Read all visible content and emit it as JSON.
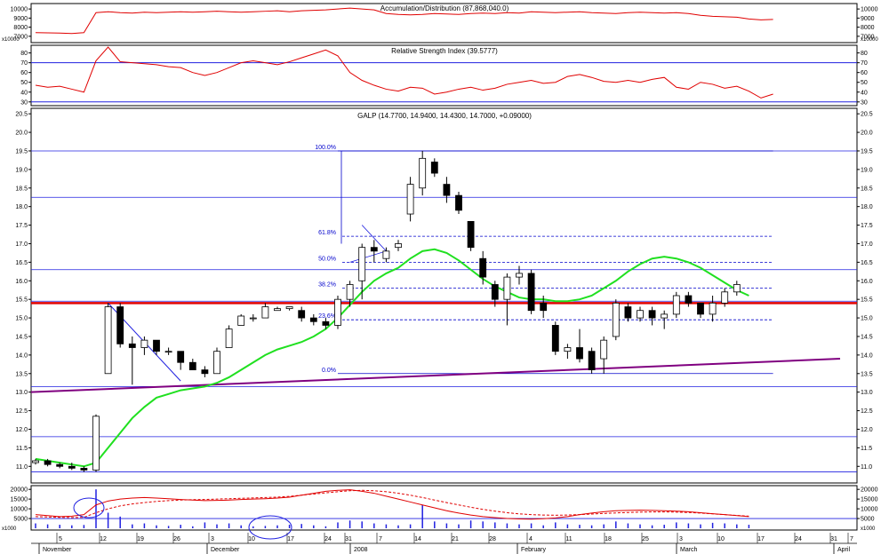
{
  "colors": {
    "frame": "#000000",
    "grid": "#c8c8c8",
    "blue_line": "#2020e0",
    "red_line": "#e00000",
    "support": "#800080",
    "ma": "#20e020",
    "fib": "#0000cc",
    "indicator": "#e00000"
  },
  "panels": {
    "ad": {
      "title": "Accumulation/Distribution (87,868,040.0)",
      "ticks": [
        "10000",
        "9000",
        "8000",
        "7000"
      ],
      "scale_label": "x10000",
      "ylim": [
        6500,
        10500
      ],
      "values": [
        7400,
        7380,
        7350,
        7300,
        7400,
        9600,
        9700,
        9600,
        9550,
        9650,
        9600,
        9650,
        9700,
        9650,
        9700,
        9750,
        9700,
        9650,
        9700,
        9750,
        9800,
        9700,
        9800,
        9850,
        9900,
        10000,
        10100,
        10000,
        9900,
        9500,
        9400,
        9350,
        9400,
        9500,
        9450,
        9400,
        9500,
        9550,
        9500,
        9600,
        9550,
        9700,
        9650,
        9600,
        9650,
        9700,
        9600,
        9550,
        9500,
        9600,
        9650,
        9600,
        9550,
        9600,
        9500,
        9300,
        9200,
        9150,
        9100,
        8900,
        8800,
        8850
      ]
    },
    "rsi": {
      "title": "Relative Strength Index (39.5777)",
      "ticks": [
        "80",
        "70",
        "60",
        "50",
        "40",
        "30"
      ],
      "ylim": [
        28,
        86
      ],
      "levels": [
        70,
        30
      ],
      "values": [
        47,
        45,
        46,
        43,
        40,
        72,
        86,
        71,
        70,
        69,
        68,
        66,
        65,
        60,
        57,
        60,
        65,
        70,
        72,
        70,
        68,
        71,
        75,
        79,
        83,
        77,
        60,
        52,
        47,
        43,
        41,
        45,
        44,
        38,
        40,
        43,
        45,
        42,
        44,
        48,
        50,
        52,
        49,
        50,
        56,
        58,
        55,
        51,
        50,
        52,
        50,
        53,
        55,
        45,
        43,
        50,
        48,
        44,
        46,
        41,
        34,
        38
      ]
    },
    "price": {
      "title": "GALP (14.7700, 14.9400, 14.4300, 14.7000, +0.09000)",
      "ticks": [
        "20.5",
        "20.0",
        "19.5",
        "19.0",
        "18.5",
        "18.0",
        "17.5",
        "17.0",
        "16.5",
        "16.0",
        "15.5",
        "15.0",
        "14.5",
        "14.0",
        "13.5",
        "13.0",
        "12.5",
        "12.0",
        "11.5",
        "11.0"
      ],
      "ylim": [
        10.6,
        20.6
      ],
      "hlines": [
        19.5,
        18.25,
        16.3,
        15.45,
        13.15,
        11.8,
        10.85
      ],
      "resistance": 15.4,
      "fib_levels": [
        {
          "label": "100.0%",
          "value": 19.5
        },
        {
          "label": "61.8%",
          "value": 17.2
        },
        {
          "label": "50.0%",
          "value": 16.5
        },
        {
          "label": "38.2%",
          "value": 15.8
        },
        {
          "label": "23.6%",
          "value": 14.95
        },
        {
          "label": "0.0%",
          "value": 13.5
        }
      ],
      "ohlc": [
        [
          11.1,
          11.2,
          11.05,
          11.15
        ],
        [
          11.15,
          11.2,
          11.0,
          11.05
        ],
        [
          11.05,
          11.1,
          10.95,
          11.0
        ],
        [
          11.0,
          11.1,
          10.9,
          10.95
        ],
        [
          10.95,
          11.0,
          10.85,
          10.9
        ],
        [
          10.9,
          12.4,
          10.85,
          12.35
        ],
        [
          13.5,
          15.4,
          13.5,
          15.3
        ],
        [
          15.3,
          15.4,
          14.2,
          14.3
        ],
        [
          14.3,
          14.5,
          13.2,
          14.2
        ],
        [
          14.2,
          14.5,
          14.0,
          14.4
        ],
        [
          14.4,
          14.4,
          14.0,
          14.1
        ],
        [
          14.1,
          14.2,
          14.0,
          14.1
        ],
        [
          14.1,
          14.1,
          13.6,
          13.8
        ],
        [
          13.8,
          13.9,
          13.6,
          13.6
        ],
        [
          13.6,
          13.7,
          13.4,
          13.5
        ],
        [
          13.5,
          14.2,
          13.5,
          14.1
        ],
        [
          14.2,
          14.8,
          14.2,
          14.7
        ],
        [
          14.8,
          15.1,
          14.8,
          15.05
        ],
        [
          15.0,
          15.1,
          14.9,
          15.0
        ],
        [
          15.0,
          15.4,
          15.0,
          15.3
        ],
        [
          15.2,
          15.3,
          15.2,
          15.25
        ],
        [
          15.25,
          15.3,
          15.2,
          15.3
        ],
        [
          15.2,
          15.3,
          14.9,
          15.0
        ],
        [
          15.0,
          15.1,
          14.8,
          14.9
        ],
        [
          14.9,
          15.0,
          14.7,
          14.8
        ],
        [
          14.8,
          15.6,
          14.7,
          15.5
        ],
        [
          15.5,
          16.0,
          15.3,
          15.9
        ],
        [
          16.0,
          17.0,
          15.5,
          16.9
        ],
        [
          16.9,
          17.1,
          16.5,
          16.8
        ],
        [
          16.6,
          16.9,
          16.5,
          16.8
        ],
        [
          16.9,
          17.1,
          16.8,
          17.0
        ],
        [
          17.8,
          18.8,
          17.6,
          18.6
        ],
        [
          18.5,
          19.5,
          18.3,
          19.3
        ],
        [
          19.2,
          19.3,
          18.8,
          18.9
        ],
        [
          18.6,
          18.8,
          18.1,
          18.3
        ],
        [
          18.3,
          18.4,
          17.8,
          17.9
        ],
        [
          17.6,
          17.6,
          16.8,
          16.9
        ],
        [
          16.6,
          16.8,
          15.9,
          16.1
        ],
        [
          15.9,
          16.0,
          15.3,
          15.5
        ],
        [
          15.5,
          16.2,
          14.8,
          16.1
        ],
        [
          16.1,
          16.4,
          15.9,
          16.2
        ],
        [
          16.2,
          16.3,
          15.1,
          15.2
        ],
        [
          15.4,
          15.6,
          15.0,
          15.2
        ],
        [
          14.8,
          14.9,
          14.0,
          14.1
        ],
        [
          14.1,
          14.3,
          13.9,
          14.2
        ],
        [
          14.2,
          14.7,
          13.8,
          13.9
        ],
        [
          14.1,
          14.2,
          13.5,
          13.6
        ],
        [
          13.9,
          14.5,
          13.5,
          14.4
        ],
        [
          14.5,
          15.5,
          14.4,
          15.4
        ],
        [
          15.3,
          15.4,
          14.9,
          15.0
        ],
        [
          15.0,
          15.3,
          14.9,
          15.2
        ],
        [
          15.2,
          15.3,
          14.8,
          15.0
        ],
        [
          15.0,
          15.2,
          14.7,
          15.1
        ],
        [
          15.1,
          15.7,
          15.0,
          15.6
        ],
        [
          15.6,
          15.7,
          15.3,
          15.4
        ],
        [
          15.4,
          15.4,
          15.0,
          15.1
        ],
        [
          15.1,
          15.6,
          14.9,
          15.4
        ],
        [
          15.4,
          15.8,
          15.3,
          15.7
        ],
        [
          15.7,
          16.0,
          15.6,
          15.9
        ]
      ],
      "ma": [
        11.2,
        11.15,
        11.1,
        11.05,
        11.0,
        11.1,
        11.5,
        11.9,
        12.3,
        12.6,
        12.85,
        12.95,
        13.05,
        13.1,
        13.15,
        13.25,
        13.4,
        13.6,
        13.8,
        14.0,
        14.15,
        14.25,
        14.35,
        14.5,
        14.7,
        15.0,
        15.35,
        15.7,
        16.0,
        16.2,
        16.35,
        16.6,
        16.8,
        16.85,
        16.75,
        16.55,
        16.3,
        16.05,
        15.85,
        15.7,
        15.55,
        15.5,
        15.5,
        15.45,
        15.45,
        15.5,
        15.6,
        15.8,
        16.0,
        16.25,
        16.45,
        16.6,
        16.65,
        16.6,
        16.5,
        16.35,
        16.15,
        15.95,
        15.75,
        15.6
      ]
    },
    "volume": {
      "ticks": [
        "20000",
        "15000",
        "10000",
        "5000"
      ],
      "scale_label": "x1000",
      "ylim": [
        0,
        21000
      ],
      "values": [
        2500,
        2000,
        1800,
        1500,
        1700,
        20000,
        8000,
        6000,
        2000,
        2500,
        1500,
        1200,
        1800,
        1000,
        3000,
        2000,
        2500,
        1500,
        1000,
        1200,
        1500,
        1800,
        2200,
        1500,
        1000,
        3000,
        4000,
        3500,
        2500,
        2000,
        1500,
        2000,
        12000,
        3500,
        2500,
        2000,
        4000,
        3500,
        3000,
        2500,
        2000,
        2500,
        1500,
        3000,
        2000,
        1800,
        1500,
        2000,
        3500,
        2500,
        2000,
        1500,
        1800,
        3000,
        2500,
        2000,
        2800,
        2500,
        2000,
        1800
      ],
      "series_a": [
        7000,
        6500,
        6000,
        6200,
        7000,
        12000,
        14000,
        15000,
        15500,
        15800,
        15500,
        15200,
        14800,
        14500,
        14200,
        14300,
        14500,
        14800,
        15000,
        15200,
        15500,
        16000,
        17000,
        18000,
        19000,
        19500,
        19800,
        19000,
        18000,
        16500,
        15000,
        13500,
        12000,
        10500,
        9000,
        7800,
        6800,
        6000,
        5500,
        5000,
        4800,
        4700,
        4900,
        5300,
        6000,
        7000,
        7800,
        8500,
        9000,
        9200,
        9300,
        9200,
        9000,
        8800,
        8500,
        8000,
        7500,
        7000,
        6500,
        6000
      ],
      "series_b": [
        6000,
        5800,
        5600,
        5500,
        5600,
        8000,
        10000,
        11500,
        12500,
        13200,
        13800,
        14200,
        14500,
        14700,
        14800,
        15000,
        15200,
        15400,
        15600,
        15800,
        16000,
        16400,
        17000,
        17600,
        18200,
        18800,
        19300,
        19500,
        19300,
        18800,
        18000,
        17000,
        15800,
        14500,
        13200,
        12000,
        10800,
        9700,
        8800,
        8000,
        7400,
        7000,
        6800,
        6700,
        6800,
        7000,
        7300,
        7600,
        7900,
        8100,
        8300,
        8400,
        8400,
        8300,
        8100,
        7800,
        7400,
        7000,
        6600,
        6200
      ]
    }
  },
  "xaxis": {
    "day_labels": [
      "5",
      "12",
      "19",
      "26",
      "3",
      "10",
      "17",
      "24",
      "31",
      "7",
      "14",
      "21",
      "28",
      "4",
      "11",
      "18",
      "25",
      "3",
      "10",
      "17",
      "24",
      "31",
      "7"
    ],
    "month_labels": [
      "November",
      "December",
      "2008",
      "February",
      "March",
      "April"
    ]
  }
}
